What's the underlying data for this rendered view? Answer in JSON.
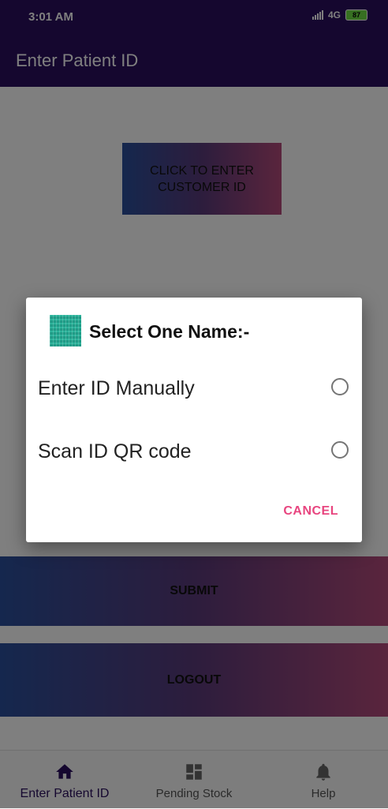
{
  "status_bar": {
    "time": "3:01 AM",
    "network": "4G",
    "battery": "87"
  },
  "app_bar": {
    "title": "Enter Patient ID"
  },
  "main": {
    "enter_button_label": "CLICK TO ENTER\nCUSTOMER ID",
    "submit_label": "SUBMIT",
    "logout_label": "LOGOUT"
  },
  "dialog": {
    "title": "Select One Name:-",
    "options": [
      {
        "label": "Enter ID Manually"
      },
      {
        "label": "Scan ID QR code"
      }
    ],
    "cancel_label": "CANCEL"
  },
  "bottom_nav": {
    "items": [
      {
        "label": "Enter Patient ID",
        "icon": "home-icon"
      },
      {
        "label": "Pending Stock",
        "icon": "dashboard-icon"
      },
      {
        "label": "Help",
        "icon": "bell-icon"
      }
    ]
  },
  "colors": {
    "primary": "#2a0f5e",
    "accent": "#e8457f",
    "gradient_start": "#2a4f9c",
    "gradient_end": "#b44a7a"
  }
}
